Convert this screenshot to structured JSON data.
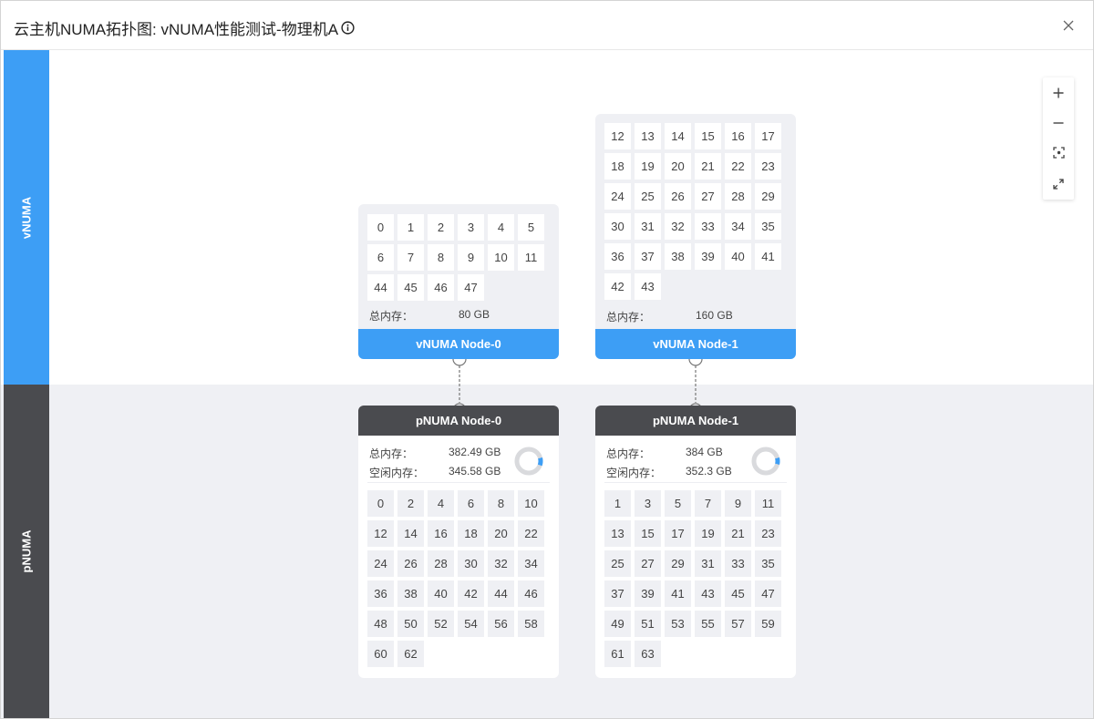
{
  "dialog": {
    "title": "云主机NUMA拓扑图: vNUMA性能测试-物理机A"
  },
  "bands": {
    "vnuma_label": "vNUMA",
    "pnuma_label": "pNUMA"
  },
  "vnodes": [
    {
      "name": "vNUMA Node-0",
      "cpus": [
        "0",
        "1",
        "2",
        "3",
        "4",
        "5",
        "6",
        "7",
        "8",
        "9",
        "10",
        "11",
        "44",
        "45",
        "46",
        "47"
      ],
      "mem_label": "总内存：",
      "mem_value": "80 GB"
    },
    {
      "name": "vNUMA Node-1",
      "cpus": [
        "12",
        "13",
        "14",
        "15",
        "16",
        "17",
        "18",
        "19",
        "20",
        "21",
        "22",
        "23",
        "24",
        "25",
        "26",
        "27",
        "28",
        "29",
        "30",
        "31",
        "32",
        "33",
        "34",
        "35",
        "36",
        "37",
        "38",
        "39",
        "40",
        "41",
        "42",
        "43"
      ],
      "mem_label": "总内存：",
      "mem_value": "160 GB"
    }
  ],
  "pnodes": [
    {
      "name": "pNUMA Node-0",
      "total_label": "总内存：",
      "total_value": "382.49 GB",
      "free_label": "空闲内存：",
      "free_value": "345.58 GB",
      "used_fraction": 0.0965,
      "cpus": [
        "0",
        "2",
        "4",
        "6",
        "8",
        "10",
        "12",
        "14",
        "16",
        "18",
        "20",
        "22",
        "24",
        "26",
        "28",
        "30",
        "32",
        "34",
        "36",
        "38",
        "40",
        "42",
        "44",
        "46",
        "48",
        "50",
        "52",
        "54",
        "56",
        "58",
        "60",
        "62"
      ]
    },
    {
      "name": "pNUMA Node-1",
      "total_label": "总内存：",
      "total_value": "384 GB",
      "free_label": "空闲内存：",
      "free_value": "352.3 GB",
      "used_fraction": 0.0826,
      "cpus": [
        "1",
        "3",
        "5",
        "7",
        "9",
        "11",
        "13",
        "15",
        "17",
        "19",
        "21",
        "23",
        "25",
        "27",
        "29",
        "31",
        "33",
        "35",
        "37",
        "39",
        "41",
        "43",
        "45",
        "47",
        "49",
        "51",
        "53",
        "55",
        "57",
        "59",
        "61",
        "63"
      ]
    }
  ],
  "toolbar": {
    "icons": [
      "zoom-in-icon",
      "zoom-out-icon",
      "fit-view-icon",
      "fullscreen-icon"
    ]
  },
  "colors": {
    "vnuma": "#3d9ef5",
    "pnuma": "#4a4b4f",
    "donut_used": "#3d9ef5",
    "donut_track": "#d9dadd"
  }
}
